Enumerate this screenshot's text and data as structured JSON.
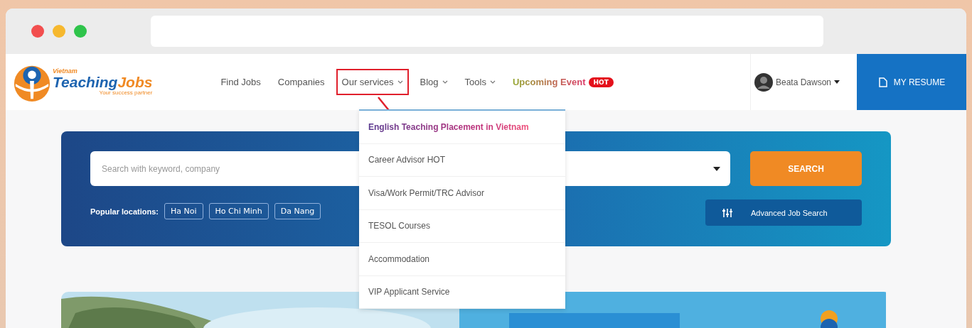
{
  "header": {
    "logo": {
      "top": "Vietnam",
      "main": "Teaching",
      "accent": "Jobs",
      "tagline": "Your success partner"
    },
    "user": {
      "name": "Beata Dawson"
    },
    "resume_button": "MY RESUME"
  },
  "nav": [
    {
      "label": "Find Jobs",
      "kind": "link",
      "dropdown": false,
      "highlighted": false
    },
    {
      "label": "Companies",
      "kind": "link",
      "dropdown": false,
      "highlighted": false
    },
    {
      "label": "Our services",
      "kind": "link",
      "dropdown": true,
      "highlighted": true
    },
    {
      "label": "Blog",
      "kind": "link",
      "dropdown": true,
      "highlighted": false
    },
    {
      "label": "Tools",
      "kind": "link",
      "dropdown": true,
      "highlighted": false
    },
    {
      "label": "Upcoming Event",
      "kind": "event",
      "dropdown": false,
      "highlighted": false,
      "badge": "HOT"
    }
  ],
  "services_menu": [
    {
      "label": "English Teaching Placement in Vietnam",
      "selected": true
    },
    {
      "label": "Career Advisor HOT",
      "selected": false
    },
    {
      "label": "Visa/Work Permit/TRC Advisor",
      "selected": false
    },
    {
      "label": "TESOL Courses",
      "selected": false
    },
    {
      "label": "Accommodation",
      "selected": false
    },
    {
      "label": "VIP Applicant Service",
      "selected": false
    }
  ],
  "search": {
    "placeholder": "Search with keyword, company",
    "button": "SEARCH",
    "popular_label": "Popular locations:",
    "locations": [
      "Ha Noi",
      "Ho Chi Minh",
      "Da Nang"
    ],
    "advanced_button": "Advanced Job Search"
  }
}
